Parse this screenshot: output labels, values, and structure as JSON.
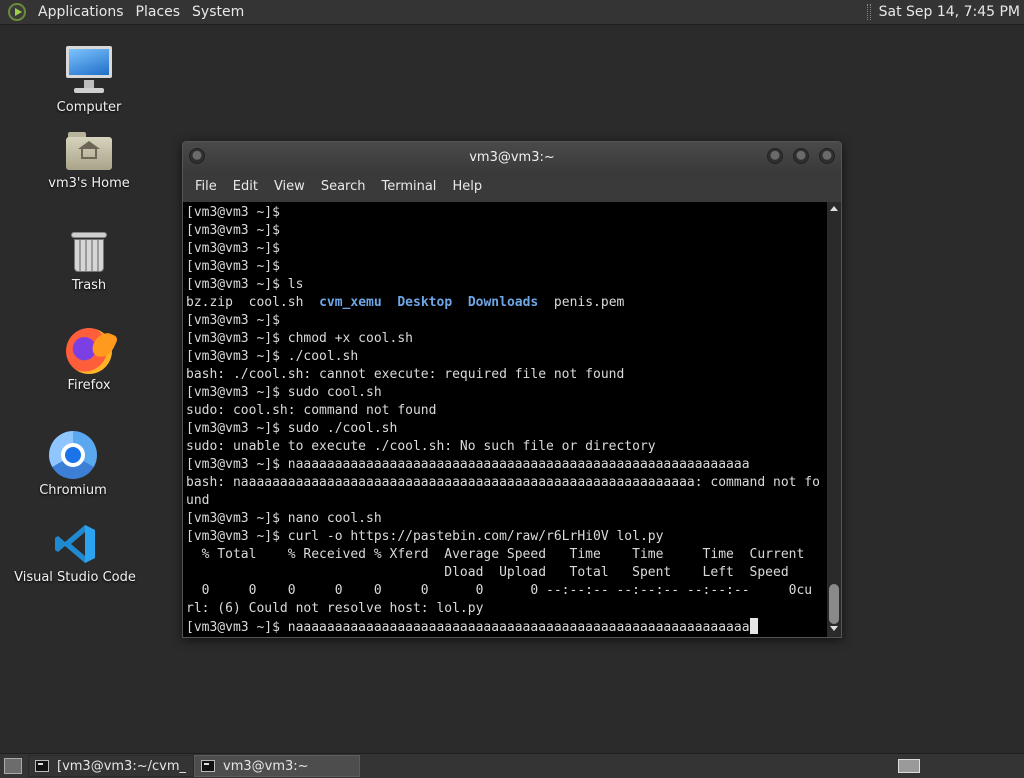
{
  "top_panel": {
    "menus": [
      "Applications",
      "Places",
      "System"
    ],
    "clock": "Sat Sep 14, 7:45 PM"
  },
  "desktop_icons": [
    {
      "label": "Computer",
      "icon": "computer-icon"
    },
    {
      "label": "vm3's Home",
      "icon": "home-folder-icon"
    },
    {
      "label": "Trash",
      "icon": "trash-icon"
    },
    {
      "label": "Firefox",
      "icon": "firefox-icon"
    },
    {
      "label": "Chromium",
      "icon": "chromium-icon"
    },
    {
      "label": "Visual Studio Code",
      "icon": "vscode-icon"
    }
  ],
  "terminal": {
    "title": "vm3@vm3:~",
    "menu": [
      "File",
      "Edit",
      "View",
      "Search",
      "Terminal",
      "Help"
    ],
    "ls_output": {
      "files": [
        "bz.zip",
        "cool.sh"
      ],
      "dirs": [
        "cvm_xemu",
        "Desktop",
        "Downloads"
      ],
      "last_file": "penis.pem"
    },
    "lines": [
      "[vm3@vm3 ~]$",
      "[vm3@vm3 ~]$",
      "[vm3@vm3 ~]$",
      "[vm3@vm3 ~]$",
      "[vm3@vm3 ~]$ ls",
      "__LS__",
      "[vm3@vm3 ~]$",
      "[vm3@vm3 ~]$ chmod +x cool.sh",
      "[vm3@vm3 ~]$ ./cool.sh",
      "bash: ./cool.sh: cannot execute: required file not found",
      "[vm3@vm3 ~]$ sudo cool.sh",
      "sudo: cool.sh: command not found",
      "[vm3@vm3 ~]$ sudo ./cool.sh",
      "sudo: unable to execute ./cool.sh: No such file or directory",
      "[vm3@vm3 ~]$ naaaaaaaaaaaaaaaaaaaaaaaaaaaaaaaaaaaaaaaaaaaaaaaaaaaaaaaaaa",
      "bash: naaaaaaaaaaaaaaaaaaaaaaaaaaaaaaaaaaaaaaaaaaaaaaaaaaaaaaaaaa: command not fo",
      "und",
      "[vm3@vm3 ~]$ nano cool.sh",
      "[vm3@vm3 ~]$ curl -o https://pastebin.com/raw/r6LrHi0V lol.py",
      "  % Total    % Received % Xferd  Average Speed   Time    Time     Time  Current",
      "                                 Dload  Upload   Total   Spent    Left  Speed",
      "  0     0    0     0    0     0      0      0 --:--:-- --:--:-- --:--:--     0cu",
      "rl: (6) Could not resolve host: lol.py",
      "[vm3@vm3 ~]$ naaaaaaaaaaaaaaaaaaaaaaaaaaaaaaaaaaaaaaaaaaaaaaaaaaaaaaaaaa"
    ]
  },
  "taskbar": {
    "tasks": [
      {
        "label": "[vm3@vm3:~/cvm_...",
        "active": false
      },
      {
        "label": "vm3@vm3:~",
        "active": true
      }
    ]
  }
}
